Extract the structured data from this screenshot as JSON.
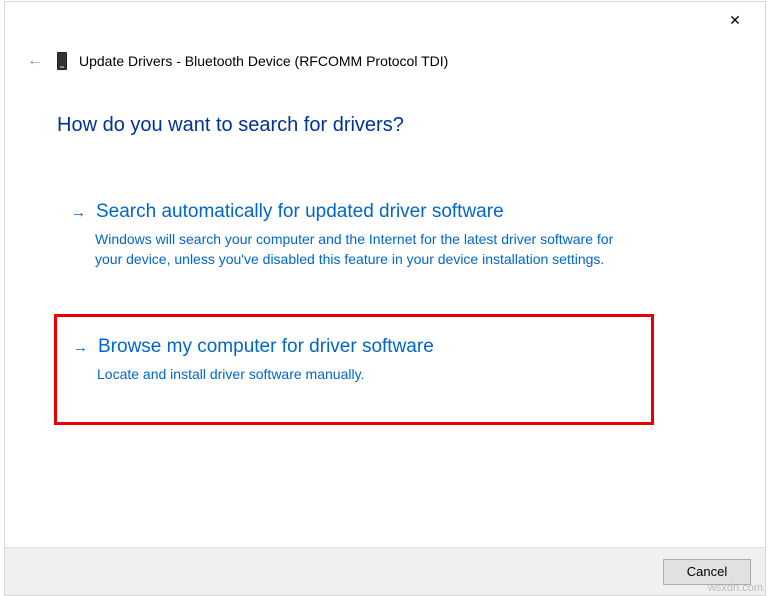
{
  "header": {
    "title": "Update Drivers - Bluetooth Device (RFCOMM Protocol TDI)"
  },
  "question": "How do you want to search for drivers?",
  "options": {
    "auto": {
      "title": "Search automatically for updated driver software",
      "desc": "Windows will search your computer and the Internet for the latest driver software for your device, unless you've disabled this feature in your device installation settings."
    },
    "browse": {
      "title": "Browse my computer for driver software",
      "desc": "Locate and install driver software manually."
    }
  },
  "footer": {
    "cancel": "Cancel"
  },
  "watermark": "wsxdn.com"
}
